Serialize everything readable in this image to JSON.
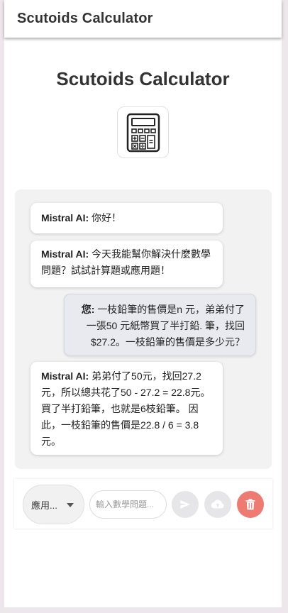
{
  "app_bar": {
    "title": "Scutoids Calculator"
  },
  "main": {
    "headline": "Scutoids Calculator",
    "logo_icon": "calculator-icon"
  },
  "chat": {
    "messages": [
      {
        "sender": "Mistral AI:",
        "text": "你好！",
        "role": "assistant"
      },
      {
        "sender": "Mistral AI:",
        "text": "今天我能幫你解決什麼數學問題？試試計算題或應用題！",
        "role": "assistant"
      },
      {
        "sender": "您:",
        "text": "一枝鉛筆的售價是n 元，弟弟付了一張50 元紙幣買了半打鉛. 筆，找回$27.2。一枝鉛筆的售價是多少元？",
        "role": "user"
      },
      {
        "sender": "Mistral AI:",
        "text": "弟弟付了50元，找回27.2元，所以總共花了50 - 27.2 = 22.8元。 買了半打鉛筆，也就是6枝鉛筆。 因此，一枝鉛筆的售價是22.8 / 6 = 3.8元。",
        "role": "assistant"
      }
    ]
  },
  "input_bar": {
    "mode_selected": "應用...",
    "question_placeholder": "輸入數學問題...",
    "question_value": "",
    "send_icon": "send-icon",
    "upload_icon": "cloud-upload-icon",
    "delete_icon": "trash-icon",
    "colors": {
      "delete": "#ee7a72",
      "neutral": "#e6e6e8"
    }
  }
}
